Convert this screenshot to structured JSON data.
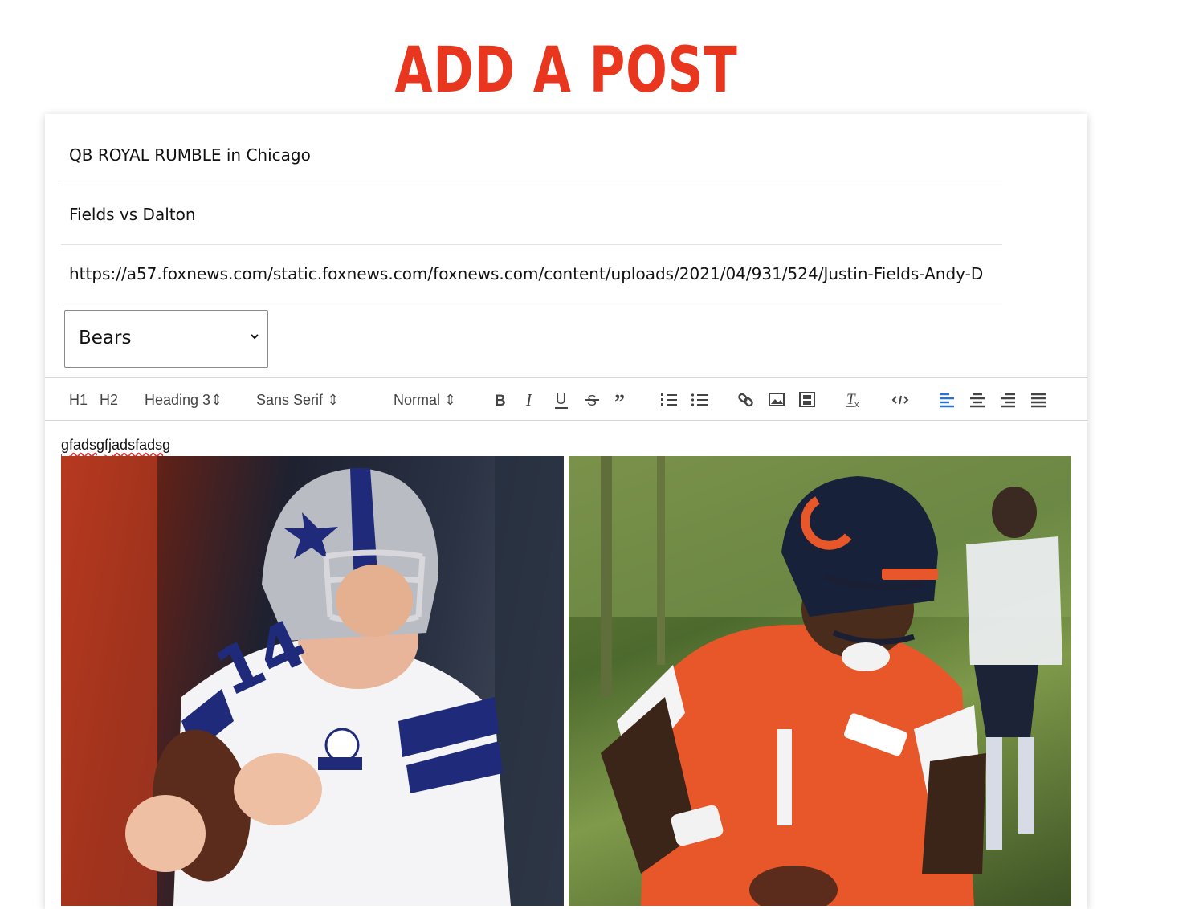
{
  "header": {
    "title": "ADD A POST"
  },
  "form": {
    "title_value": "QB ROYAL RUMBLE in Chicago",
    "subtitle_value": "Fields vs Dalton",
    "image_url_value": "https://a57.foxnews.com/static.foxnews.com/foxnews.com/content/uploads/2021/04/931/524/Justin-Fields-Andy-D",
    "team_select": {
      "selected": "Bears"
    }
  },
  "toolbar": {
    "h1": "H1",
    "h2": "H2",
    "heading_select": "Heading 3",
    "font_select": "Sans Serif",
    "size_select": "Normal",
    "align_active_color": "#2a6fd6"
  },
  "editor": {
    "text": "gfadsgfjadsfadsg",
    "images": [
      "dallas-quarterback-photo",
      "bears-quarterback-photo"
    ]
  },
  "colors": {
    "title": "#e8361f",
    "bears_orange": "#e8572a",
    "cowboys_blue": "#1f2b7a"
  }
}
